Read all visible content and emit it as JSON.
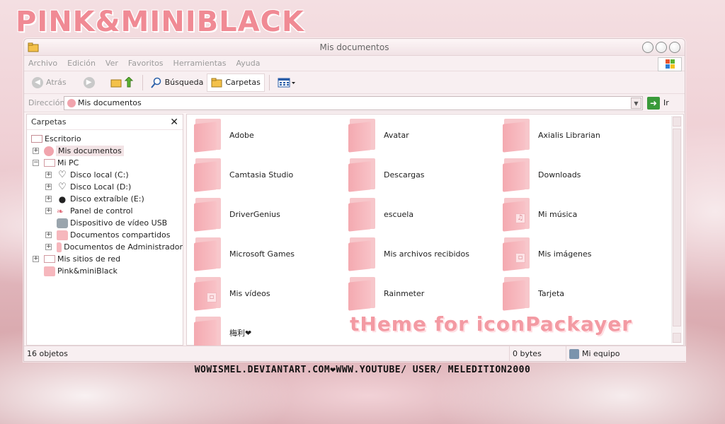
{
  "theme_title": "PINK&MINIBLACK",
  "window": {
    "title": "Mis documentos",
    "menu": [
      "Archivo",
      "Edición",
      "Ver",
      "Favoritos",
      "Herramientas",
      "Ayuda"
    ],
    "toolbar": {
      "back_label": "Atrás",
      "search_label": "Búsqueda",
      "folders_label": "Carpetas"
    },
    "address": {
      "label": "Dirección",
      "value": "Mis documentos",
      "go_label": "Ir"
    }
  },
  "folders_pane": {
    "title": "Carpetas",
    "close_glyph": "✕",
    "tree": [
      {
        "label": "Escritorio",
        "icon": "desktop-icon"
      },
      {
        "label": "Mis documentos",
        "icon": "my-documents-icon",
        "selected": true
      },
      {
        "label": "Mi PC",
        "icon": "my-computer-icon"
      },
      {
        "label": "Disco local (C:)",
        "icon": "heart-drive-icon"
      },
      {
        "label": "Disco Local (D:)",
        "icon": "heart-drive-icon"
      },
      {
        "label": "Disco extraíble (E:)",
        "icon": "mouse-drive-icon"
      },
      {
        "label": "Panel de control",
        "icon": "control-panel-icon"
      },
      {
        "label": "Dispositivo de vídeo USB",
        "icon": "usb-camera-icon"
      },
      {
        "label": "Documentos compartidos",
        "icon": "folder-icon"
      },
      {
        "label": "Documentos de Administrador",
        "icon": "folder-icon"
      },
      {
        "label": "Mis sitios de red",
        "icon": "network-icon"
      },
      {
        "label": "Pink&miniBlack",
        "icon": "folder-icon"
      }
    ]
  },
  "files": [
    {
      "label": "Adobe"
    },
    {
      "label": "Avatar"
    },
    {
      "label": "Axialis Librarian"
    },
    {
      "label": "Camtasia Studio"
    },
    {
      "label": "Descargas"
    },
    {
      "label": "Downloads"
    },
    {
      "label": "DriverGenius"
    },
    {
      "label": "escuela"
    },
    {
      "label": "Mi música",
      "overlay": "♫"
    },
    {
      "label": "Microsoft Games"
    },
    {
      "label": "Mis archivos recibidos"
    },
    {
      "label": "Mis imágenes",
      "overlay": "▫"
    },
    {
      "label": "Mis vídeos",
      "overlay": "▫"
    },
    {
      "label": "Rainmeter"
    },
    {
      "label": "Tarjeta"
    },
    {
      "label": "梅利❤"
    }
  ],
  "banner": "tHeme for iconPackayer",
  "status": {
    "count": "16 objetos",
    "size": "0 bytes",
    "location": "Mi equipo"
  },
  "credits": "WOWISMEL.DEVIANTART.COM❤WWW.YOUTUBE/ USER/ MELEDITION2000",
  "colors": {
    "accent_pink": "#f08a94",
    "folder_pink": "#f6b7bd"
  }
}
